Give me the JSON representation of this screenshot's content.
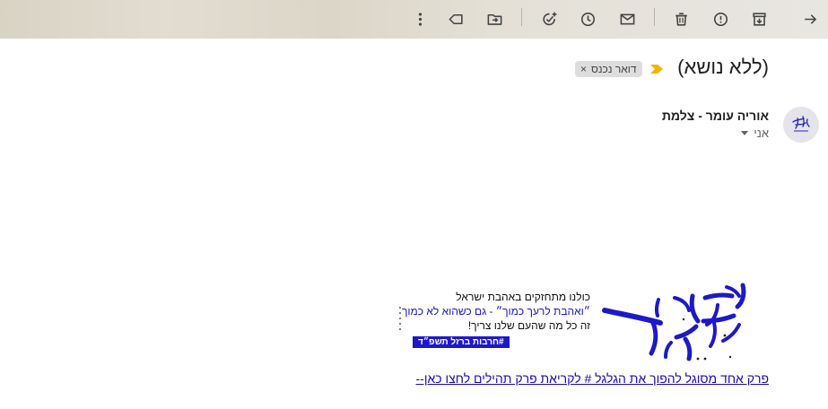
{
  "toolbar": {
    "buttons": [
      "back-arrow-icon",
      "archive-icon",
      "report-spam-icon",
      "delete-icon",
      "mark-unread-icon",
      "snooze-icon",
      "add-task-icon",
      "move-to-icon",
      "label-icon",
      "more-icon"
    ]
  },
  "email": {
    "subject": "(ללא נושא)",
    "label": "דואר נכנס",
    "label_remove": "×",
    "sender_name": "אוריה עומר - צלמת",
    "recipient": "אני",
    "importance_color": "#f4b400"
  },
  "banner": {
    "line1": "כולנו מתחזקים באהבת ישראל",
    "line2": "״ואהבת לרעך כמוך״ - גם כשהוא לא כמוך",
    "line3": "זה כל מה שהעם שלנו צריך!",
    "hashtag": "#חרבות ברזל תשפ״ד",
    "accent_color": "#1d18c9"
  },
  "footer": {
    "link_text": "פרק אחד מסוגל להפוך את הגלגל # לקריאת פרק תהילים לחצו כאן--"
  }
}
